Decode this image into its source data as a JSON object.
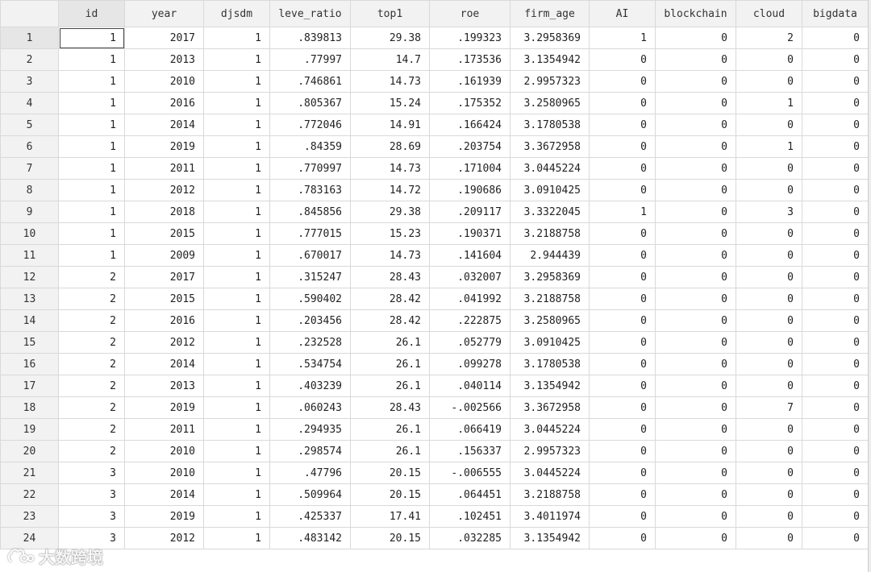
{
  "grid": {
    "columns": [
      "id",
      "year",
      "djsdm",
      "leve_ratio",
      "top1",
      "roe",
      "firm_age",
      "AI",
      "blockchain",
      "cloud",
      "bigdata"
    ],
    "rows": [
      {
        "n": "1",
        "cells": [
          "1",
          "2017",
          "1",
          ".839813",
          "29.38",
          ".199323",
          "3.2958369",
          "1",
          "0",
          "2",
          "0"
        ]
      },
      {
        "n": "2",
        "cells": [
          "1",
          "2013",
          "1",
          ".77997",
          "14.7",
          ".173536",
          "3.1354942",
          "0",
          "0",
          "0",
          "0"
        ]
      },
      {
        "n": "3",
        "cells": [
          "1",
          "2010",
          "1",
          ".746861",
          "14.73",
          ".161939",
          "2.9957323",
          "0",
          "0",
          "0",
          "0"
        ]
      },
      {
        "n": "4",
        "cells": [
          "1",
          "2016",
          "1",
          ".805367",
          "15.24",
          ".175352",
          "3.2580965",
          "0",
          "0",
          "1",
          "0"
        ]
      },
      {
        "n": "5",
        "cells": [
          "1",
          "2014",
          "1",
          ".772046",
          "14.91",
          ".166424",
          "3.1780538",
          "0",
          "0",
          "0",
          "0"
        ]
      },
      {
        "n": "6",
        "cells": [
          "1",
          "2019",
          "1",
          ".84359",
          "28.69",
          ".203754",
          "3.3672958",
          "0",
          "0",
          "1",
          "0"
        ]
      },
      {
        "n": "7",
        "cells": [
          "1",
          "2011",
          "1",
          ".770997",
          "14.73",
          ".171004",
          "3.0445224",
          "0",
          "0",
          "0",
          "0"
        ]
      },
      {
        "n": "8",
        "cells": [
          "1",
          "2012",
          "1",
          ".783163",
          "14.72",
          ".190686",
          "3.0910425",
          "0",
          "0",
          "0",
          "0"
        ]
      },
      {
        "n": "9",
        "cells": [
          "1",
          "2018",
          "1",
          ".845856",
          "29.38",
          ".209117",
          "3.3322045",
          "1",
          "0",
          "3",
          "0"
        ]
      },
      {
        "n": "10",
        "cells": [
          "1",
          "2015",
          "1",
          ".777015",
          "15.23",
          ".190371",
          "3.2188758",
          "0",
          "0",
          "0",
          "0"
        ]
      },
      {
        "n": "11",
        "cells": [
          "1",
          "2009",
          "1",
          ".670017",
          "14.73",
          ".141604",
          "2.944439",
          "0",
          "0",
          "0",
          "0"
        ]
      },
      {
        "n": "12",
        "cells": [
          "2",
          "2017",
          "1",
          ".315247",
          "28.43",
          ".032007",
          "3.2958369",
          "0",
          "0",
          "0",
          "0"
        ]
      },
      {
        "n": "13",
        "cells": [
          "2",
          "2015",
          "1",
          ".590402",
          "28.42",
          ".041992",
          "3.2188758",
          "0",
          "0",
          "0",
          "0"
        ]
      },
      {
        "n": "14",
        "cells": [
          "2",
          "2016",
          "1",
          ".203456",
          "28.42",
          ".222875",
          "3.2580965",
          "0",
          "0",
          "0",
          "0"
        ]
      },
      {
        "n": "15",
        "cells": [
          "2",
          "2012",
          "1",
          ".232528",
          "26.1",
          ".052779",
          "3.0910425",
          "0",
          "0",
          "0",
          "0"
        ]
      },
      {
        "n": "16",
        "cells": [
          "2",
          "2014",
          "1",
          ".534754",
          "26.1",
          ".099278",
          "3.1780538",
          "0",
          "0",
          "0",
          "0"
        ]
      },
      {
        "n": "17",
        "cells": [
          "2",
          "2013",
          "1",
          ".403239",
          "26.1",
          ".040114",
          "3.1354942",
          "0",
          "0",
          "0",
          "0"
        ]
      },
      {
        "n": "18",
        "cells": [
          "2",
          "2019",
          "1",
          ".060243",
          "28.43",
          "-.002566",
          "3.3672958",
          "0",
          "0",
          "7",
          "0"
        ]
      },
      {
        "n": "19",
        "cells": [
          "2",
          "2011",
          "1",
          ".294935",
          "26.1",
          ".066419",
          "3.0445224",
          "0",
          "0",
          "0",
          "0"
        ]
      },
      {
        "n": "20",
        "cells": [
          "2",
          "2010",
          "1",
          ".298574",
          "26.1",
          ".156337",
          "2.9957323",
          "0",
          "0",
          "0",
          "0"
        ]
      },
      {
        "n": "21",
        "cells": [
          "3",
          "2010",
          "1",
          ".47796",
          "20.15",
          "-.006555",
          "3.0445224",
          "0",
          "0",
          "0",
          "0"
        ]
      },
      {
        "n": "22",
        "cells": [
          "3",
          "2014",
          "1",
          ".509964",
          "20.15",
          ".064451",
          "3.2188758",
          "0",
          "0",
          "0",
          "0"
        ]
      },
      {
        "n": "23",
        "cells": [
          "3",
          "2019",
          "1",
          ".425337",
          "17.41",
          ".102451",
          "3.4011974",
          "0",
          "0",
          "0",
          "0"
        ]
      },
      {
        "n": "24",
        "cells": [
          "3",
          "2012",
          "1",
          ".483142",
          "20.15",
          ".032285",
          "3.1354942",
          "0",
          "0",
          "0",
          "0"
        ]
      }
    ]
  },
  "watermark": {
    "text": "大数跨境",
    "icon": "logo-icon"
  }
}
